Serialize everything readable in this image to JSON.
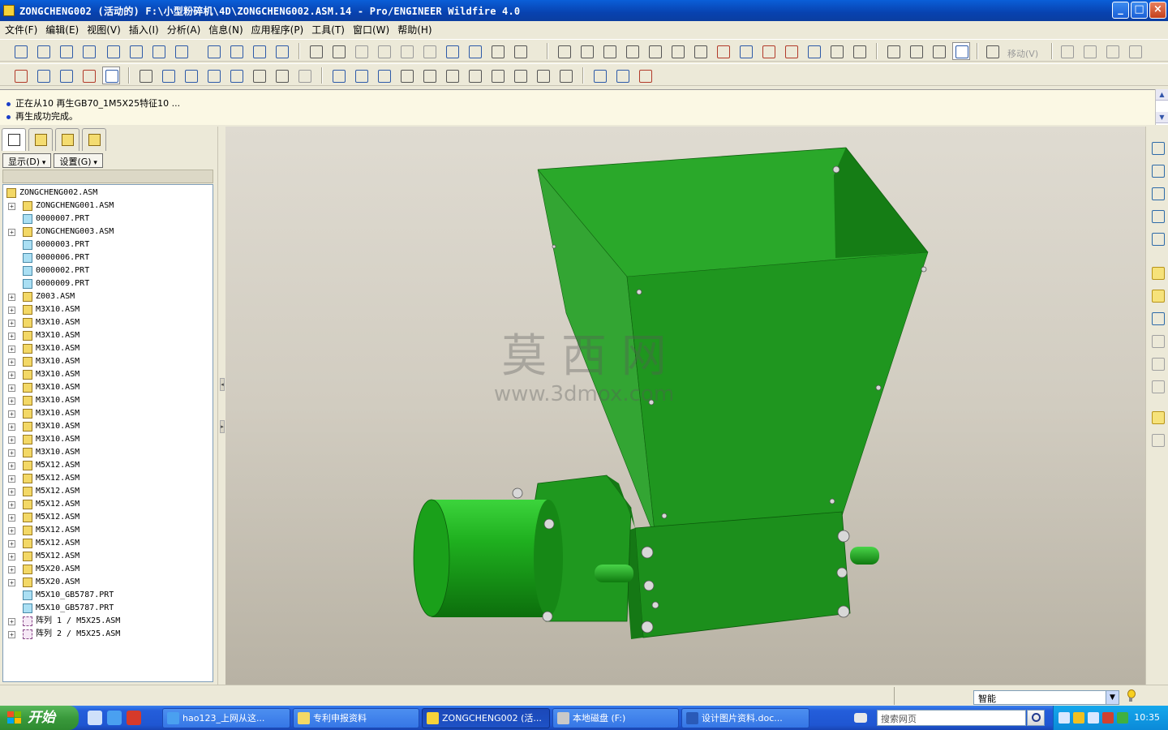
{
  "window": {
    "title": "ZONGCHENG002 (活动的) F:\\小型粉碎机\\4D\\ZONGCHENG002.ASM.14 - Pro/ENGINEER Wildfire 4.0",
    "buttons": [
      "_",
      "□",
      "×"
    ]
  },
  "menu": [
    "文件(F)",
    "编辑(E)",
    "视图(V)",
    "插入(I)",
    "分析(A)",
    "信息(N)",
    "应用程序(P)",
    "工具(T)",
    "窗口(W)",
    "帮助(H)"
  ],
  "toolbar": {
    "move_label": "移动(V)"
  },
  "messages": [
    "正在从10 再生GB70_1M5X25特征10 ...",
    "再生成功完成。"
  ],
  "model_tree": {
    "display_btn": "显示(D)",
    "settings_btn": "设置(G)",
    "items": [
      {
        "label": "ZONGCHENG002.ASM",
        "type": "asm",
        "level": 0,
        "expand": false
      },
      {
        "label": "ZONGCHENG001.ASM",
        "type": "asm",
        "level": 1,
        "expand": true
      },
      {
        "label": "0000007.PRT",
        "type": "prt",
        "level": 1,
        "expand": false
      },
      {
        "label": "ZONGCHENG003.ASM",
        "type": "asm",
        "level": 1,
        "expand": true
      },
      {
        "label": "0000003.PRT",
        "type": "prt",
        "level": 1,
        "expand": false
      },
      {
        "label": "0000006.PRT",
        "type": "prt",
        "level": 1,
        "expand": false
      },
      {
        "label": "0000002.PRT",
        "type": "prt",
        "level": 1,
        "expand": false
      },
      {
        "label": "0000009.PRT",
        "type": "prt",
        "level": 1,
        "expand": false
      },
      {
        "label": "Z003.ASM",
        "type": "asm",
        "level": 1,
        "expand": true
      },
      {
        "label": "M3X10.ASM",
        "type": "asm",
        "level": 1,
        "expand": true
      },
      {
        "label": "M3X10.ASM",
        "type": "asm",
        "level": 1,
        "expand": true
      },
      {
        "label": "M3X10.ASM",
        "type": "asm",
        "level": 1,
        "expand": true
      },
      {
        "label": "M3X10.ASM",
        "type": "asm",
        "level": 1,
        "expand": true
      },
      {
        "label": "M3X10.ASM",
        "type": "asm",
        "level": 1,
        "expand": true
      },
      {
        "label": "M3X10.ASM",
        "type": "asm",
        "level": 1,
        "expand": true
      },
      {
        "label": "M3X10.ASM",
        "type": "asm",
        "level": 1,
        "expand": true
      },
      {
        "label": "M3X10.ASM",
        "type": "asm",
        "level": 1,
        "expand": true
      },
      {
        "label": "M3X10.ASM",
        "type": "asm",
        "level": 1,
        "expand": true
      },
      {
        "label": "M3X10.ASM",
        "type": "asm",
        "level": 1,
        "expand": true
      },
      {
        "label": "M3X10.ASM",
        "type": "asm",
        "level": 1,
        "expand": true
      },
      {
        "label": "M3X10.ASM",
        "type": "asm",
        "level": 1,
        "expand": true
      },
      {
        "label": "M5X12.ASM",
        "type": "asm",
        "level": 1,
        "expand": true
      },
      {
        "label": "M5X12.ASM",
        "type": "asm",
        "level": 1,
        "expand": true
      },
      {
        "label": "M5X12.ASM",
        "type": "asm",
        "level": 1,
        "expand": true
      },
      {
        "label": "M5X12.ASM",
        "type": "asm",
        "level": 1,
        "expand": true
      },
      {
        "label": "M5X12.ASM",
        "type": "asm",
        "level": 1,
        "expand": true
      },
      {
        "label": "M5X12.ASM",
        "type": "asm",
        "level": 1,
        "expand": true
      },
      {
        "label": "M5X12.ASM",
        "type": "asm",
        "level": 1,
        "expand": true
      },
      {
        "label": "M5X12.ASM",
        "type": "asm",
        "level": 1,
        "expand": true
      },
      {
        "label": "M5X20.ASM",
        "type": "asm",
        "level": 1,
        "expand": true
      },
      {
        "label": "M5X20.ASM",
        "type": "asm",
        "level": 1,
        "expand": true
      },
      {
        "label": "M5X10_GB5787.PRT",
        "type": "prt",
        "level": 1,
        "expand": false
      },
      {
        "label": "M5X10_GB5787.PRT",
        "type": "prt",
        "level": 1,
        "expand": false
      },
      {
        "label": "阵列 1 / M5X25.ASM",
        "type": "pat",
        "level": 1,
        "expand": true
      },
      {
        "label": "阵列 2 / M5X25.ASM",
        "type": "pat",
        "level": 1,
        "expand": true
      }
    ]
  },
  "watermark": {
    "text1": "莫 西 网",
    "text2": "www.3dmox.com"
  },
  "status": {
    "filter_value": "智能"
  },
  "taskbar": {
    "start": "开始",
    "tasks": [
      "hao123_上网从这...",
      "专利申报资料",
      "ZONGCHENG002 (活...",
      "本地磁盘 (F:)",
      "设计图片资料.doc..."
    ],
    "search_placeholder": "搜索网页",
    "clock": "10:35"
  },
  "colors": {
    "part_green": "#1f9d1f",
    "title_blue": "#0a5fd8"
  }
}
